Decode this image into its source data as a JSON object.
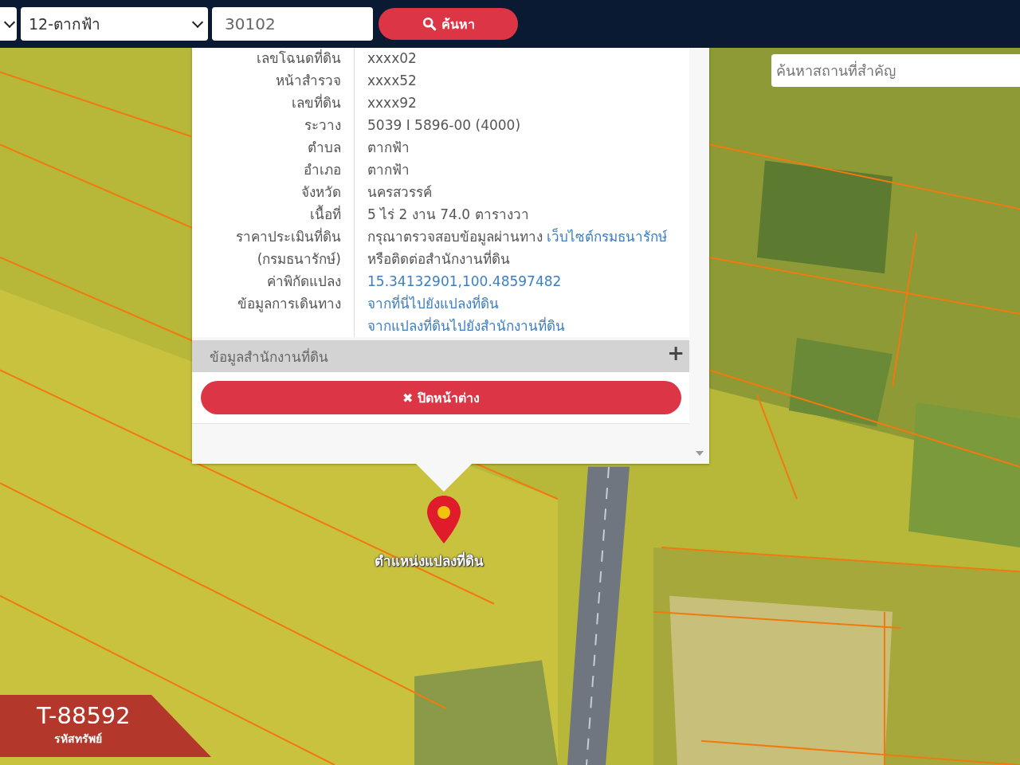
{
  "toolbar": {
    "district_select": {
      "value": "12-ตากฟ้า"
    },
    "parcel_field": {
      "value": "30102"
    },
    "search_button": {
      "label": "ค้นหา"
    }
  },
  "map": {
    "place_search": {
      "placeholder": "ค้นหาสถานที่สำคัญ"
    },
    "marker": {
      "label": "ตำแหน่งแปลงที่ดิน"
    }
  },
  "popup": {
    "rows": [
      {
        "label": "เลขโฉนดที่ดิน",
        "values": [
          {
            "text": "xxxx02",
            "kind": "text"
          }
        ]
      },
      {
        "label": "หน้าสำรวจ",
        "values": [
          {
            "text": "xxxx52",
            "kind": "text"
          }
        ]
      },
      {
        "label": "เลขที่ดิน",
        "values": [
          {
            "text": "xxxx92",
            "kind": "text"
          }
        ]
      },
      {
        "label": "ระวาง",
        "values": [
          {
            "text": "5039 I 5896-00 (4000)",
            "kind": "text"
          }
        ]
      },
      {
        "label": "ตำบล",
        "values": [
          {
            "text": "ตากฟ้า",
            "kind": "text"
          }
        ]
      },
      {
        "label": "อำเภอ",
        "values": [
          {
            "text": "ตากฟ้า",
            "kind": "text"
          }
        ]
      },
      {
        "label": "จังหวัด",
        "values": [
          {
            "text": "นครสวรรค์",
            "kind": "text"
          }
        ]
      },
      {
        "label": "เนื้อที่",
        "values": [
          {
            "text": "5 ไร่ 2 งาน 74.0 ตารางวา",
            "kind": "text"
          }
        ]
      },
      {
        "label": "ราคาประเมินที่ดิน",
        "values": [
          {
            "text": "กรุณาตรวจสอบข้อมูลผ่านทาง",
            "link": "เว็บไซต์กรมธนารักษ์",
            "kind": "text_link"
          }
        ]
      },
      {
        "label": "(กรมธนารักษ์)",
        "values": [
          {
            "text": "หรือติดต่อสำนักงานที่ดิน",
            "kind": "text"
          }
        ]
      },
      {
        "label": "ค่าพิกัดแปลง",
        "values": [
          {
            "text": "15.34132901,100.48597482",
            "kind": "link"
          }
        ]
      },
      {
        "label": "ข้อมูลการเดินทาง",
        "values": [
          {
            "text": "จากที่นี่ไปยังแปลงที่ดิน",
            "kind": "link"
          },
          {
            "text": "จากแปลงที่ดินไปยังสำนักงานที่ดิน",
            "kind": "link"
          }
        ]
      }
    ],
    "section": {
      "title": "ข้อมูลสำนักงานที่ดิน",
      "expanded": false,
      "toggle": "+"
    },
    "close_button": {
      "icon": "✖",
      "label": "ปิดหน้าต่าง"
    }
  },
  "badge": {
    "code": "T-88592",
    "caption": "รหัสทรัพย์"
  }
}
